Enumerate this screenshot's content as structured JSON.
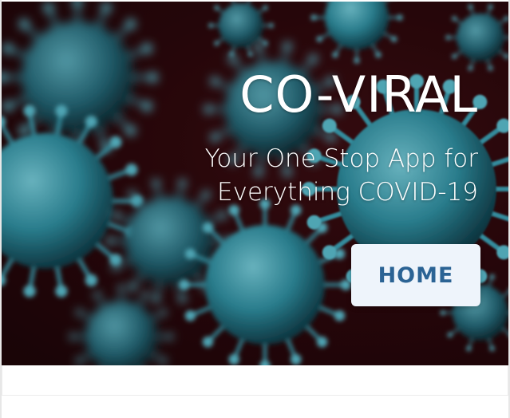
{
  "hero": {
    "title": "CO-VIRAL",
    "subtitle": "Your One Stop App for Everything COVID-19",
    "background_image": "coronavirus-particles",
    "colors": {
      "background": "#2a070b",
      "virus": "#4fc6d8",
      "text": "#ffffff"
    }
  },
  "nav": {
    "home_label": "HOME"
  },
  "button_colors": {
    "background": "#eef4fb",
    "text": "#2b6394"
  }
}
